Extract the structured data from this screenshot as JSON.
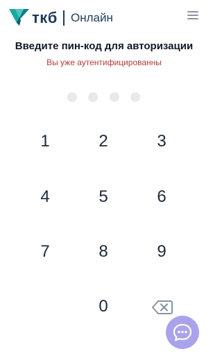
{
  "header": {
    "brand": "ткб",
    "subtitle": "Онлайн",
    "logo_icon": "tkb-logo-icon",
    "menu_icon": "hamburger-menu-icon"
  },
  "auth": {
    "title": "Введите пин-код для авторизации",
    "error": "Вы уже аутентифицированны",
    "pin_length": 4,
    "pin_filled": 0
  },
  "keypad": {
    "keys": [
      "1",
      "2",
      "3",
      "4",
      "5",
      "6",
      "7",
      "8",
      "9",
      "0"
    ],
    "backspace_icon": "backspace-icon"
  },
  "chat": {
    "icon": "chat-bubble-icon"
  },
  "colors": {
    "brand_dark": "#1e3a5a",
    "brand_teal": "#1aa9a1",
    "brand_teal_dark": "#0f7f86",
    "error": "#b23b3b",
    "dot_empty": "#e7e9ec",
    "chat_fab": "#a9a3ec"
  }
}
